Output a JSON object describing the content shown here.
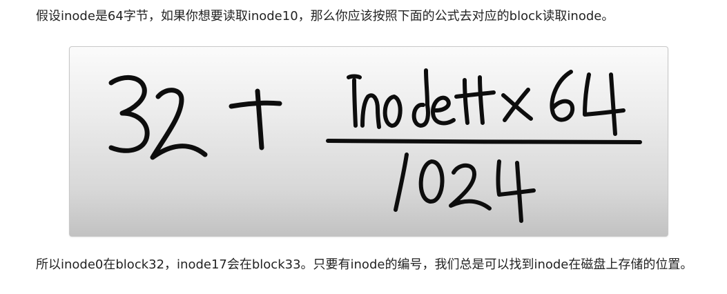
{
  "intro_text": "假设inode是64字节，如果你想要读取inode10，那么你应该按照下面的公式去对应的block读取inode。",
  "formula": {
    "term_constant": "32",
    "operator": "+",
    "numerator": "inode# × 64",
    "denominator": "1024"
  },
  "conclusion_text": "所以inode0在block32，inode17会在block33。只要有inode的编号，我们总是可以找到inode在磁盘上存储的位置。"
}
